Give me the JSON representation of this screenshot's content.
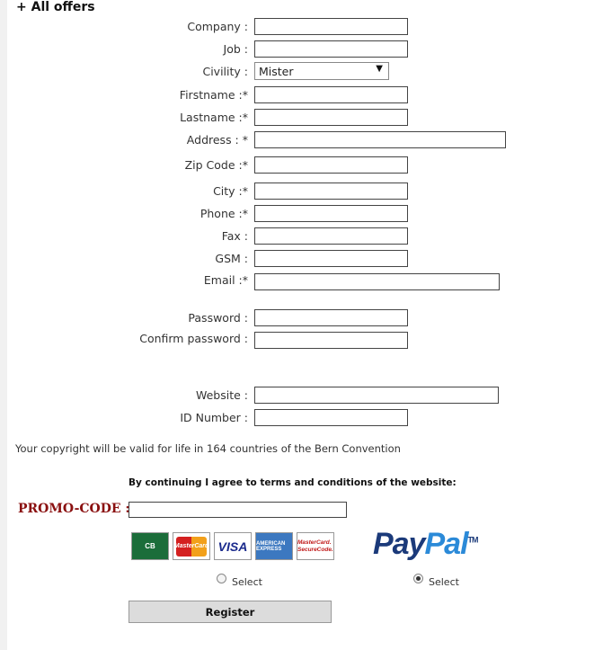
{
  "header": {
    "title": "+ All offers"
  },
  "form": {
    "company_label": "Company :",
    "job_label": "Job :",
    "civility_label": "Civility :",
    "civility_value": "Mister",
    "firstname_label": "Firstname :*",
    "lastname_label": "Lastname :*",
    "address_label": "Address : *",
    "zip_label": "Zip Code :*",
    "city_label": "City :*",
    "phone_label": "Phone :*",
    "fax_label": "Fax :",
    "gsm_label": "GSM :",
    "email_label": "Email :*",
    "password_label": "Password :",
    "confirm_label": "Confirm password :",
    "website_label": "Website :",
    "id_label": "ID Number :"
  },
  "copyright_text": "Your copyright will be valid for life in 164 countries of the Bern Convention",
  "terms_text": "By continuing I agree to terms and conditions of the website:",
  "promo": {
    "label": "PROMO-CODE :"
  },
  "payment": {
    "cards": [
      "CB",
      "MasterCard",
      "VISA",
      "AMERICAN EXPRESS",
      "MasterCard. SecureCode."
    ],
    "paypal_pay": "Pay",
    "paypal_pal": "Pal",
    "paypal_tm": "TM",
    "card_select_label": "Select",
    "paypal_select_label": "Select"
  },
  "register_label": "Register"
}
